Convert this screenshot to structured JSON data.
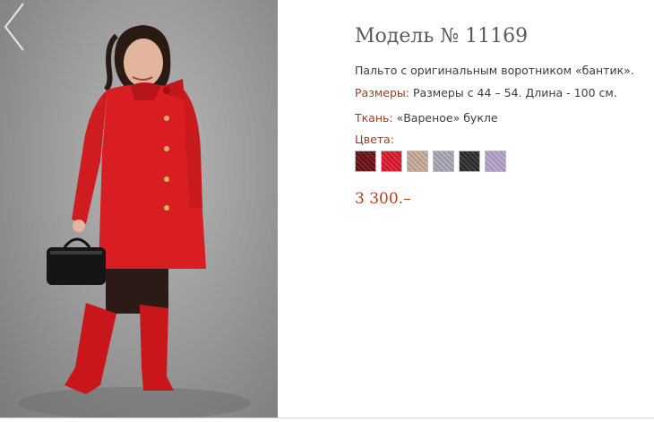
{
  "product": {
    "title": "Модель № 11169",
    "description": "Пальто с оригинальным воротником «бантик».",
    "sizes_label": "Размеры:",
    "sizes_value": " Размеры с 44 – 54. Длина - 100 см.",
    "fabric_label": "Ткань:",
    "fabric_value": " «Вареное» букле",
    "colors_label": "Цвета:",
    "swatches": [
      {
        "name": "dark-red-boucle",
        "color": "#6a0d12"
      },
      {
        "name": "red",
        "color": "#e3162b"
      },
      {
        "name": "beige-boucle",
        "color": "#c8ad96"
      },
      {
        "name": "light-grey-boucle",
        "color": "#a7abb6"
      },
      {
        "name": "black-boucle",
        "color": "#2b2b2b"
      },
      {
        "name": "lilac-boucle",
        "color": "#b8a3cc"
      }
    ],
    "price": "3 300.–"
  },
  "icons": {
    "prev": "chevron-left-icon"
  }
}
